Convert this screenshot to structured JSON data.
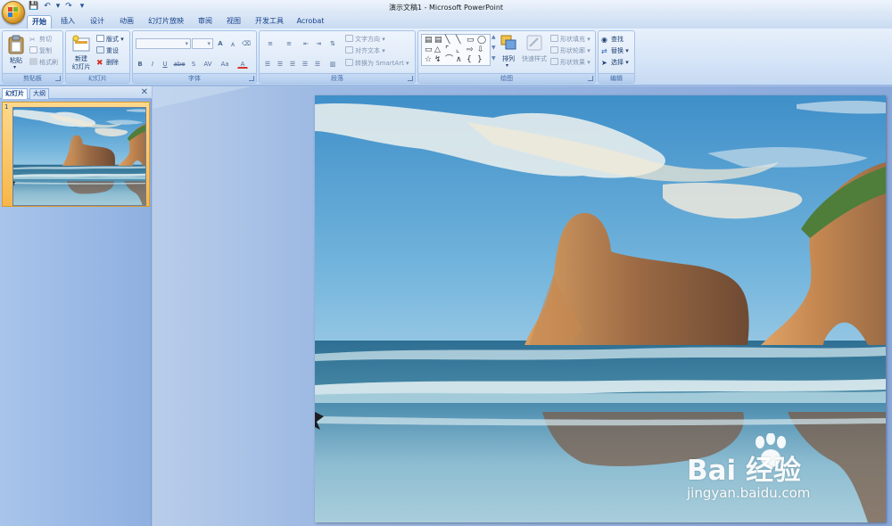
{
  "window": {
    "title": "演示文稿1 - Microsoft PowerPoint"
  },
  "quick_access": {
    "save": "save-icon",
    "undo": "undo-icon",
    "redo": "redo-icon",
    "customize": "▾"
  },
  "tabs": [
    {
      "label": "开始",
      "active": true
    },
    {
      "label": "插入"
    },
    {
      "label": "设计"
    },
    {
      "label": "动画"
    },
    {
      "label": "幻灯片放映"
    },
    {
      "label": "审阅"
    },
    {
      "label": "视图"
    },
    {
      "label": "开发工具"
    },
    {
      "label": "Acrobat"
    }
  ],
  "ribbon": {
    "clipboard": {
      "label": "剪贴板",
      "paste": "粘贴",
      "cut": "剪切",
      "copy": "复制",
      "format_painter": "格式刷"
    },
    "slides": {
      "label": "幻灯片",
      "new_slide_1": "新建",
      "new_slide_2": "幻灯片",
      "layout": "版式",
      "reset": "重设",
      "delete": "删除"
    },
    "font": {
      "label": "字体",
      "bold": "B",
      "italic": "I",
      "underline": "U",
      "strike": "abe",
      "shadow": "S",
      "spacing": "AV",
      "case": "Aa",
      "color": "A",
      "grow": "A",
      "shrink": "A"
    },
    "paragraph": {
      "label": "段落",
      "text_direction": "文字方向",
      "align_text": "对齐文本",
      "convert_smartart": "转换为 SmartArt"
    },
    "drawing": {
      "label": "绘图",
      "arrange": "排列",
      "quick_styles": "快速样式",
      "shape_fill": "形状填充",
      "shape_outline": "形状轮廓",
      "shape_effects": "形状效果"
    },
    "editing": {
      "label": "编辑",
      "find": "查找",
      "replace": "替换",
      "select": "选择"
    }
  },
  "pane": {
    "tab_slides": "幻灯片",
    "tab_outline": "大纲",
    "slide_number": "1"
  },
  "watermark": {
    "brand": "Bai 经验",
    "url": "jingyan.baidu.com"
  },
  "colors": {
    "ribbon_bg": "#d5e4f7",
    "selected_thumb": "#f7b64a",
    "pane_bg": "#9fbbe4"
  }
}
